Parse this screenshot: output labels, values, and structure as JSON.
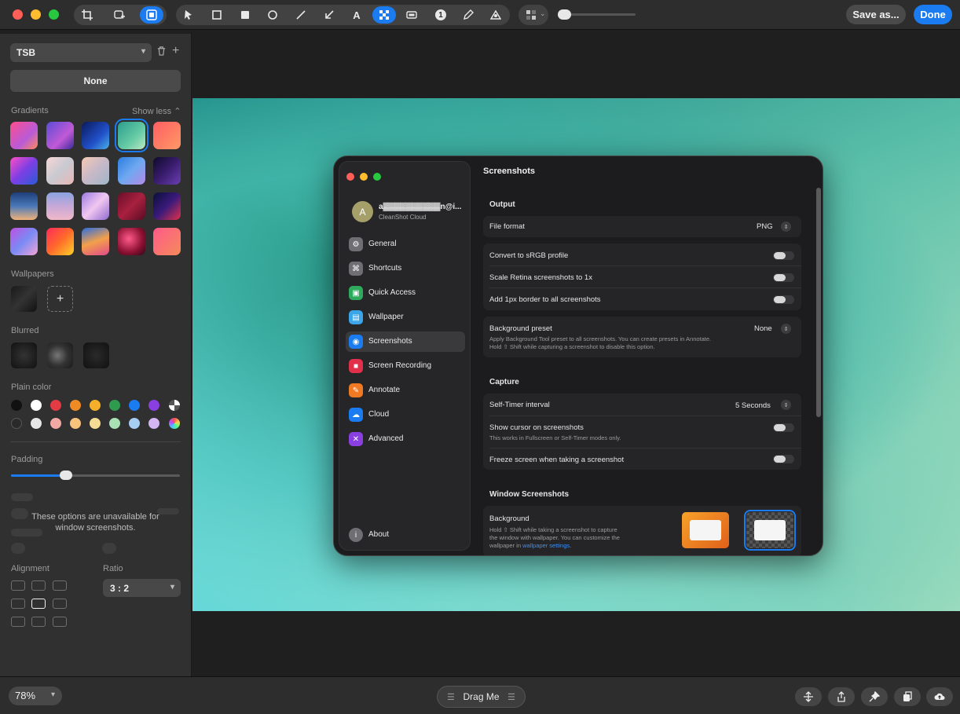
{
  "toolbar": {
    "save_as_label": "Save as...",
    "done_label": "Done",
    "icons": [
      "crop-icon",
      "add-image-icon",
      "background-icon",
      "pointer-icon",
      "rectangle-icon",
      "filled-rectangle-icon",
      "ellipse-icon",
      "line-icon",
      "arrow-icon",
      "text-icon",
      "pixelate-icon",
      "highlight-icon",
      "counter-icon",
      "pencil-icon",
      "spotlight-icon",
      "blur-tool-icon"
    ],
    "counter_glyph": "1",
    "text_glyph": "A"
  },
  "sidebar": {
    "preset_value": "TSB",
    "none_label": "None",
    "gradients_label": "Gradients",
    "show_less_label": "Show less",
    "wallpapers_label": "Wallpapers",
    "blurred_label": "Blurred",
    "plain_color_label": "Plain color",
    "padding_label": "Padding",
    "padding_level": 0.33,
    "unavailable_text": "These options are unavailable for window screenshots.",
    "alignment_label": "Alignment",
    "ratio_label": "Ratio",
    "ratio_value": "3 : 2",
    "plain_colors_row1": [
      "#111111",
      "#ffffff",
      "#e23b44",
      "#f08a24",
      "#f5b02b",
      "#2e9b4e",
      "#1a7cf0",
      "#8a3fe0"
    ],
    "plain_colors_row2": [
      "#2a2a2a",
      "#e6e6e6",
      "#f2a9a4",
      "#f7c27c",
      "#f5dc95",
      "#a9e2b5",
      "#a8cdf5",
      "#d3b5f3"
    ]
  },
  "settings_window": {
    "title": "Screenshots",
    "account_initial": "A",
    "account_name": "a▓▓▓▓▓▓▓▓▓▓n@i...",
    "account_sub": "CleanShot Cloud",
    "nav": [
      "General",
      "Shortcuts",
      "Quick Access",
      "Wallpaper",
      "Screenshots",
      "Screen Recording",
      "Annotate",
      "Cloud",
      "Advanced"
    ],
    "about_label": "About",
    "output": {
      "title": "Output",
      "file_format_label": "File format",
      "file_format_value": "PNG",
      "srgb_label": "Convert to sRGB profile",
      "scale_label": "Scale Retina screenshots to 1x",
      "border_label": "Add 1px border to all screenshots",
      "bg_preset_label": "Background preset",
      "bg_preset_value": "None",
      "bg_preset_desc1": "Apply Background Tool preset to all screenshots. You can create presets in Annotate.",
      "bg_preset_desc2": "Hold ⇧ Shift while capturing a screenshot to disable this option."
    },
    "capture": {
      "title": "Capture",
      "timer_label": "Self-Timer interval",
      "timer_value": "5 Seconds",
      "cursor_label": "Show cursor on screenshots",
      "cursor_desc": "This works in Fullscreen or Self-Timer modes only.",
      "freeze_label": "Freeze screen when taking a screenshot"
    },
    "window_screenshots": {
      "title": "Window Screenshots",
      "background_label": "Background",
      "background_desc1": "Hold ⇧ Shift while taking a screenshot to capture",
      "background_desc2": "the window with wallpaper. You can customize the",
      "background_desc3": "wallpaper in ",
      "background_link": "wallpaper settings",
      "background_desc_end": "."
    }
  },
  "bottombar": {
    "zoom_value": "78%",
    "drag_label": "Drag Me",
    "icons": [
      "drag-move-icon",
      "share-icon",
      "pin-icon",
      "copy-icon",
      "upload-cloud-icon"
    ]
  },
  "colors": {
    "accent": "#1a7cf0",
    "window_bg": "#1c1c1e",
    "sidebar_bg": "#303030"
  }
}
